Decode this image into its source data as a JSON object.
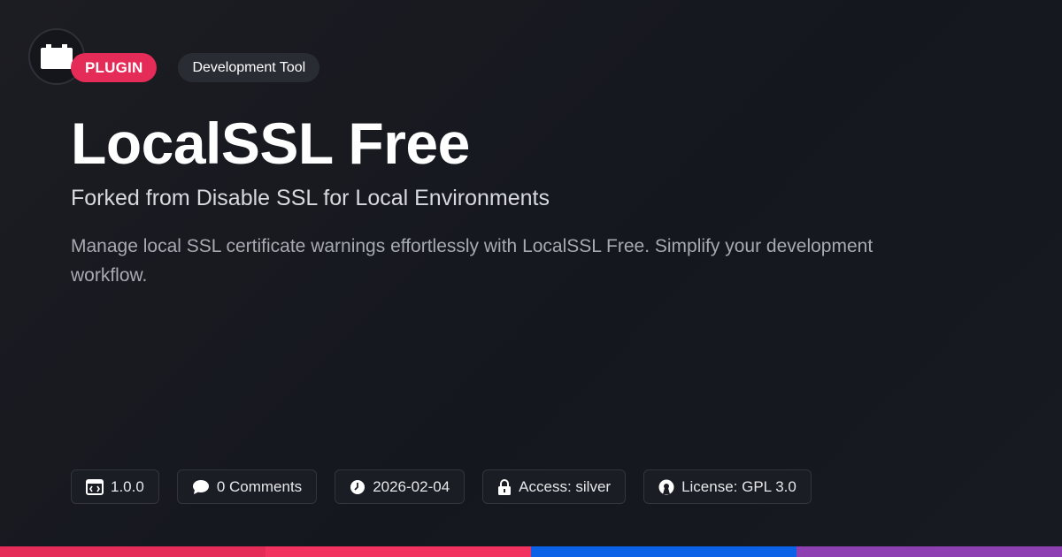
{
  "header": {
    "logo_icon": "plugin-block-icon",
    "badge_type": "PLUGIN",
    "badge_category": "Development Tool"
  },
  "main": {
    "title": "LocalSSL Free",
    "subtitle": "Forked from Disable SSL for Local Environments",
    "description": "Manage local SSL certificate warnings effortlessly with LocalSSL Free. Simplify your development workflow."
  },
  "meta": {
    "version": "1.0.0",
    "comments": "0 Comments",
    "date": "2026-02-04",
    "access": "Access: silver",
    "license": "License: GPL 3.0"
  },
  "colors": {
    "accent": "#e52b57",
    "bar": [
      "#e52b57",
      "#f3335f",
      "#0c62e6",
      "#8e3fb1"
    ]
  }
}
